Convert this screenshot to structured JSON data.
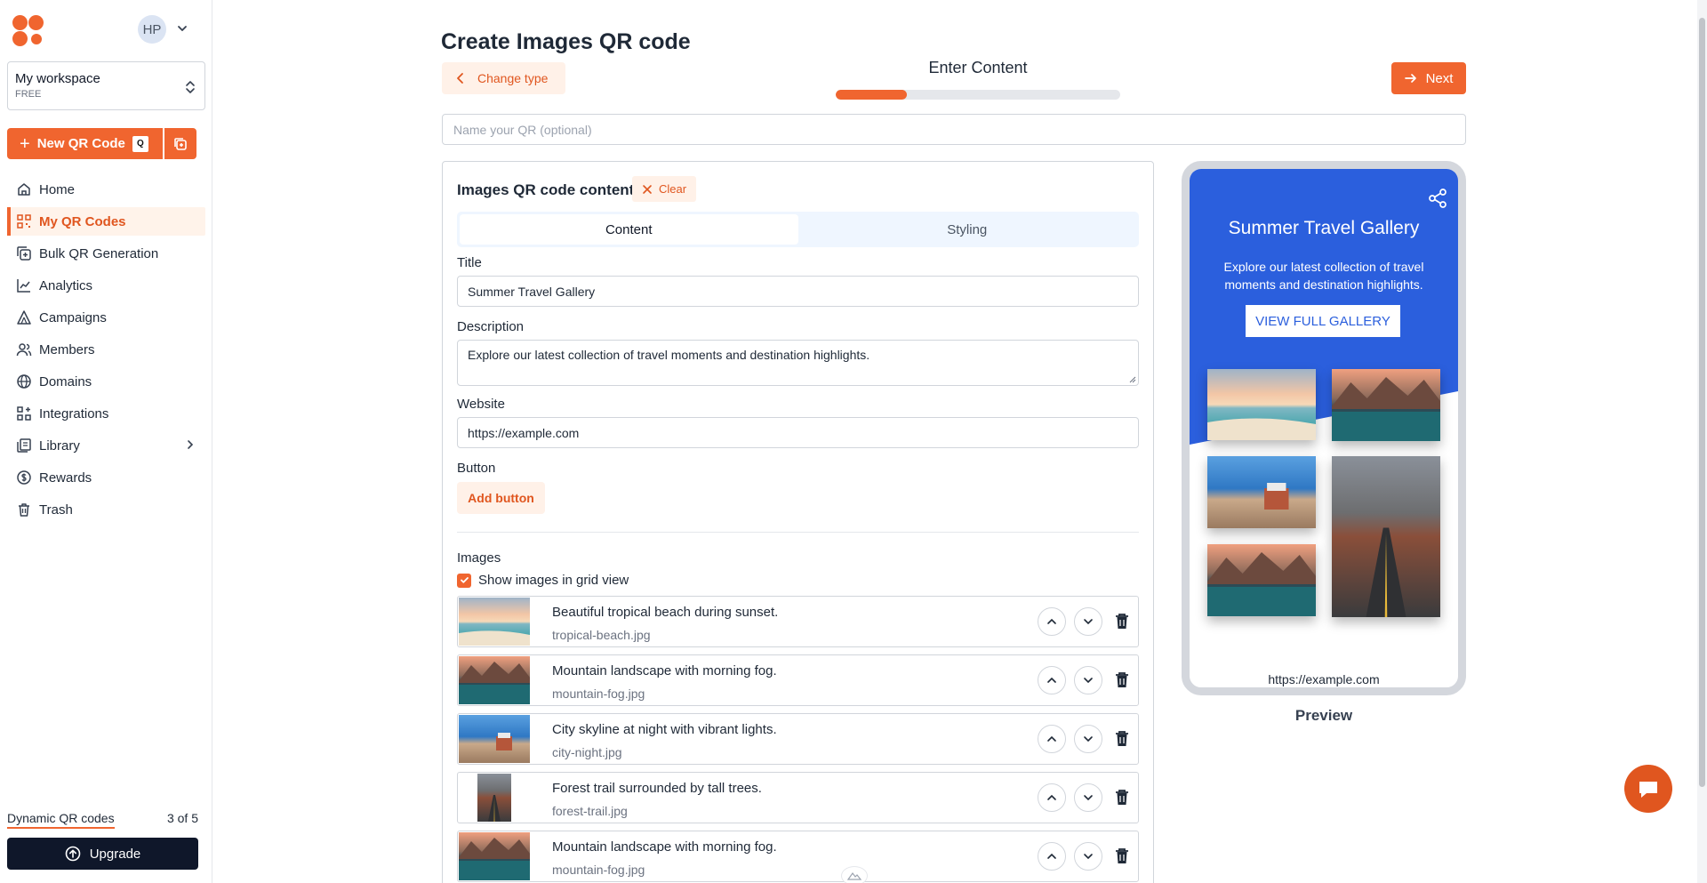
{
  "user": {
    "initials": "HP"
  },
  "workspace": {
    "name": "My workspace",
    "plan": "FREE"
  },
  "new_qr": {
    "label": "New QR Code",
    "shortcut": "Q"
  },
  "nav": [
    {
      "label": "Home",
      "icon": "home-icon"
    },
    {
      "label": "My QR Codes",
      "icon": "qr-grid-icon",
      "active": true
    },
    {
      "label": "Bulk QR Generation",
      "icon": "bulk-icon"
    },
    {
      "label": "Analytics",
      "icon": "analytics-icon"
    },
    {
      "label": "Campaigns",
      "icon": "campaigns-icon"
    },
    {
      "label": "Members",
      "icon": "members-icon"
    },
    {
      "label": "Domains",
      "icon": "globe-icon"
    },
    {
      "label": "Integrations",
      "icon": "integrations-icon"
    },
    {
      "label": "Library",
      "icon": "library-icon"
    },
    {
      "label": "Rewards",
      "icon": "dollar-icon"
    },
    {
      "label": "Trash",
      "icon": "trash-icon"
    }
  ],
  "usage": {
    "label": "Dynamic QR codes",
    "count": "3 of 5"
  },
  "upgrade_label": "Upgrade",
  "header": {
    "title": "Create Images QR code",
    "change_type": "Change type",
    "step": "Enter Content",
    "progress_fraction": 0.25,
    "next": "Next",
    "name_placeholder": "Name your QR (optional)"
  },
  "content": {
    "title": "Images QR code content",
    "clear": "Clear",
    "tabs": [
      "Content",
      "Styling"
    ],
    "title_label": "Title",
    "title_value": "Summer Travel Gallery",
    "description_label": "Description",
    "description_value": "Explore our latest collection of travel moments and destination highlights.",
    "website_label": "Website",
    "website_value": "https://example.com",
    "button_label": "Button",
    "add_button": "Add button",
    "images_label": "Images",
    "grid_view_label": "Show images in grid view",
    "images": [
      {
        "caption": "Beautiful tropical beach during sunset.",
        "file": "tropical-beach.jpg"
      },
      {
        "caption": "Mountain landscape with morning fog.",
        "file": "mountain-fog.jpg"
      },
      {
        "caption": "City skyline at night with vibrant lights.",
        "file": "city-night.jpg"
      },
      {
        "caption": "Forest trail surrounded by tall trees.",
        "file": "forest-trail.jpg"
      },
      {
        "caption": "Mountain landscape with morning fog.",
        "file": "mountain-fog.jpg"
      }
    ]
  },
  "preview": {
    "title": "Summer Travel Gallery",
    "description": "Explore our latest collection of travel moments and destination highlights.",
    "button": "VIEW FULL GALLERY",
    "url": "https://example.com",
    "label": "Preview"
  },
  "colors": {
    "accent": "#f0652f",
    "preview_blue": "#2b5fdd",
    "dark": "#0f172a"
  }
}
